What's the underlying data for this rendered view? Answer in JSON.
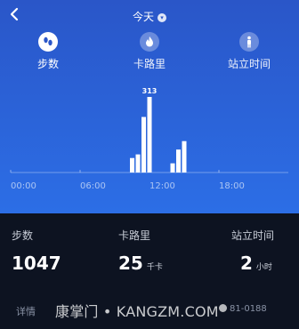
{
  "header": {
    "back_icon": "chevron-left-icon",
    "title": "今天",
    "dropdown_icon": "chevron-down-icon"
  },
  "tabs": [
    {
      "label": "步数",
      "icon": "footsteps-icon",
      "selected": true
    },
    {
      "label": "卡路里",
      "icon": "flame-icon",
      "selected": false
    },
    {
      "label": "站立时间",
      "icon": "person-standing-icon",
      "selected": false
    }
  ],
  "chart_data": {
    "type": "bar",
    "x": [
      10.5,
      11.0,
      11.5,
      12.0,
      14.0,
      14.5,
      15.0
    ],
    "values": [
      60,
      75,
      230,
      313,
      38,
      95,
      130
    ],
    "x_ticks": [
      "00:00",
      "06:00",
      "12:00",
      "18:00"
    ],
    "x_tick_values": [
      0,
      6,
      12,
      18
    ],
    "xlim": [
      0,
      24
    ],
    "ylim": [
      0,
      313
    ],
    "peak_label": "313",
    "bar_color": "#ffffff"
  },
  "stats": [
    {
      "label": "步数",
      "value": "1047",
      "unit": ""
    },
    {
      "label": "卡路里",
      "value": "25",
      "unit": "千卡"
    },
    {
      "label": "站立时间",
      "value": "2",
      "unit": "小时"
    }
  ],
  "footer": {
    "detail_label": "详情",
    "watermark": "康掌门 • KANGZM.COM",
    "trailing_text": "81-0188"
  }
}
